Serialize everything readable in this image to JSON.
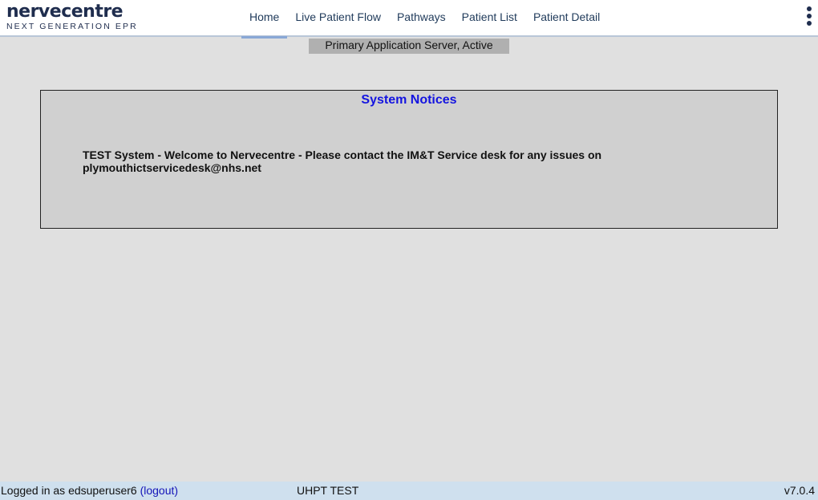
{
  "header": {
    "logo": {
      "name": "nervecentre",
      "tagline": "NEXT GENERATION EPR"
    },
    "nav": [
      {
        "label": "Home",
        "active": true
      },
      {
        "label": "Live Patient Flow",
        "active": false
      },
      {
        "label": "Pathways",
        "active": false
      },
      {
        "label": "Patient List",
        "active": false
      },
      {
        "label": "Patient Detail",
        "active": false
      }
    ],
    "menu_icon": "vertical-ellipsis-icon"
  },
  "server_status": "Primary Application Server, Active",
  "notices": {
    "title": "System Notices",
    "text": "TEST System - Welcome to Nervecentre - Please contact the IM&T Service desk for any issues on plymouthictservicedesk@nhs.net"
  },
  "footer": {
    "logged_in_text": "Logged in as edsuperuser6",
    "logout_label": "(logout)",
    "environment": "UHPT TEST",
    "version": "v7.0.4"
  },
  "colors": {
    "brand": "#1f2d4e",
    "notice_title": "#1414e0",
    "footer_bg": "#cfe0ee",
    "active_tab_underline": "#8aa8d6"
  }
}
